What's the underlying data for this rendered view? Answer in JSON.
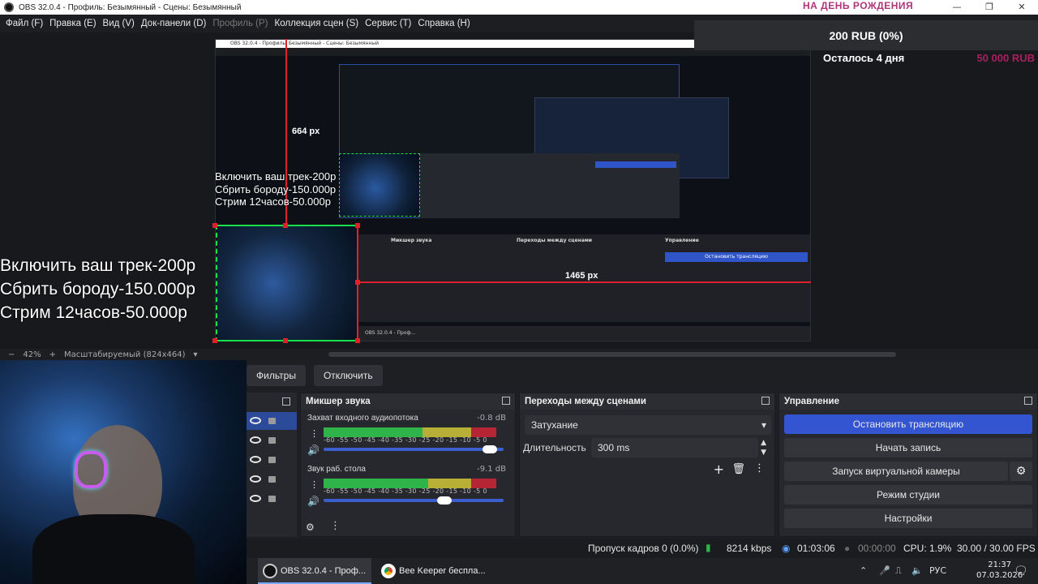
{
  "window": {
    "title": "OBS 32.0.4 - Профиль: Безымянный - Сцены: Безымянный",
    "promo": "НА ДЕНЬ РОЖДЕНИЯ",
    "minimize": "—",
    "maximize": "❐",
    "close": "✕"
  },
  "menu": [
    "Файл (F)",
    "Правка (E)",
    "Вид (V)",
    "Док-панели (D)",
    "Профиль (P)",
    "Коллекция сцен (S)",
    "Сервис (T)",
    "Справка (H)"
  ],
  "donation": {
    "amount": "200 RUB (0%)",
    "remaining": "Осталось 4 дня",
    "goal": "50 000 RUB"
  },
  "overlay": {
    "line1": "Включить ваш трек-200р",
    "line2": "Сбрить бороду-150.000р",
    "line3": "Стрим 12часов-50.000р"
  },
  "measure": {
    "vertical": "664 px",
    "horizontal": "1465 px"
  },
  "zoom": {
    "value": "42%",
    "mode": "Масштабируемый (824x464)"
  },
  "toolbar": {
    "filters": "Фильтры",
    "disable": "Отключить"
  },
  "mixer": {
    "title": "Микшер звука",
    "channels": [
      {
        "name": "Захват входного аудиопотока",
        "db": "-0.8 dB",
        "volume": 0.92
      },
      {
        "name": "Звук раб. стола",
        "db": "-9.1 dB",
        "volume": 0.66
      }
    ],
    "scale": "-60 -55 -50 -45 -40 -35 -30 -25 -20 -15 -10 -5 0"
  },
  "transitions": {
    "title": "Переходы между сценами",
    "type": "Затухание",
    "duration_label": "Длительность",
    "duration": "300 ms"
  },
  "controls": {
    "title": "Управление",
    "stop_stream": "Остановить трансляцию",
    "start_record": "Начать запись",
    "virtual_cam": "Запуск виртуальной камеры",
    "studio_mode": "Режим студии",
    "settings": "Настройки"
  },
  "status": {
    "dropped": "Пропуск кадров 0 (0.0%)",
    "bitrate": "8214 kbps",
    "stream_time": "01:03:06",
    "rec_time": "00:00:00",
    "cpu": "CPU: 1.9%",
    "fps": "30.00 / 30.00 FPS"
  },
  "taskbar": {
    "obs": "OBS 32.0.4 - Проф...",
    "browser": "Bee Keeper беспла...",
    "lang": "РУС",
    "time": "21:37",
    "date": "07.03.2026"
  },
  "colors": {
    "accent": "#3455d1",
    "meter_green": "#2fb449",
    "meter_yellow": "#b8b036",
    "meter_red": "#b62536",
    "guide_red": "#e0202a",
    "promo": "#b0347a"
  }
}
